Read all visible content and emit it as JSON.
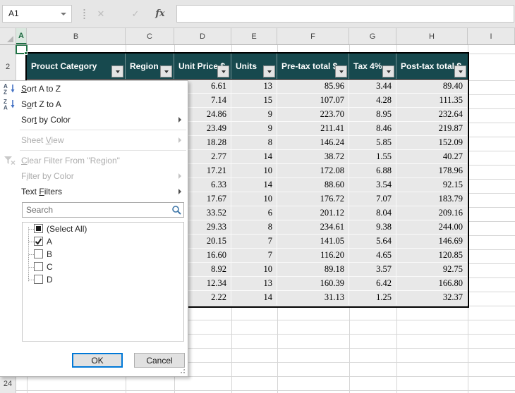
{
  "formula_bar": {
    "name_box_value": "A1",
    "cancel_glyph": "✕",
    "enter_glyph": "✓",
    "fx_label": "fx",
    "formula_value": ""
  },
  "sheet": {
    "column_headers": [
      "A",
      "B",
      "C",
      "D",
      "E",
      "F",
      "G",
      "H",
      "I"
    ],
    "active_column": "A",
    "row_top_label": "2",
    "row_bottom_label": "24"
  },
  "table": {
    "headers": [
      {
        "label": "Prouct Category"
      },
      {
        "label": "Region"
      },
      {
        "label": "Unit Price $"
      },
      {
        "label": "Units"
      },
      {
        "label": "Pre-tax total $"
      },
      {
        "label": "Tax 4%"
      },
      {
        "label": "Post-tax total $"
      }
    ],
    "rows": [
      [
        "6.61",
        "13",
        "85.96",
        "3.44",
        "89.40"
      ],
      [
        "7.14",
        "15",
        "107.07",
        "4.28",
        "111.35"
      ],
      [
        "24.86",
        "9",
        "223.70",
        "8.95",
        "232.64"
      ],
      [
        "23.49",
        "9",
        "211.41",
        "8.46",
        "219.87"
      ],
      [
        "18.28",
        "8",
        "146.24",
        "5.85",
        "152.09"
      ],
      [
        "2.77",
        "14",
        "38.72",
        "1.55",
        "40.27"
      ],
      [
        "17.21",
        "10",
        "172.08",
        "6.88",
        "178.96"
      ],
      [
        "6.33",
        "14",
        "88.60",
        "3.54",
        "92.15"
      ],
      [
        "17.67",
        "10",
        "176.72",
        "7.07",
        "183.79"
      ],
      [
        "33.52",
        "6",
        "201.12",
        "8.04",
        "209.16"
      ],
      [
        "29.33",
        "8",
        "234.61",
        "9.38",
        "244.00"
      ],
      [
        "20.15",
        "7",
        "141.05",
        "5.64",
        "146.69"
      ],
      [
        "16.60",
        "7",
        "116.20",
        "4.65",
        "120.85"
      ],
      [
        "8.92",
        "10",
        "89.18",
        "3.57",
        "92.75"
      ],
      [
        "12.34",
        "13",
        "160.39",
        "6.42",
        "166.80"
      ],
      [
        "2.22",
        "14",
        "31.13",
        "1.25",
        "32.37"
      ]
    ]
  },
  "filter_menu": {
    "items": [
      {
        "label": "Sort A to Z",
        "underline_index": 0,
        "icon": "sort-az-icon",
        "enabled": true,
        "submenu": false
      },
      {
        "label": "Sort Z to A",
        "underline_index": 1,
        "icon": "sort-za-icon",
        "enabled": true,
        "submenu": false
      },
      {
        "label": "Sort by Color",
        "underline_index": 3,
        "enabled": true,
        "submenu": true
      },
      {
        "separator": true
      },
      {
        "label": "Sheet View",
        "underline_index": 6,
        "enabled": false,
        "submenu": true
      },
      {
        "separator": true
      },
      {
        "label": "Clear Filter From \"Region\"",
        "underline_index": 0,
        "icon": "clear-filter-icon",
        "enabled": false,
        "submenu": false
      },
      {
        "label": "Filter by Color",
        "underline_index": 1,
        "enabled": false,
        "submenu": true
      },
      {
        "label": "Text Filters",
        "underline_index": 5,
        "enabled": true,
        "submenu": true
      }
    ],
    "search_placeholder": "Search",
    "checkbox_items": [
      {
        "label": "(Select All)",
        "state": "indeterminate"
      },
      {
        "label": "A",
        "state": "checked"
      },
      {
        "label": "B",
        "state": "unchecked"
      },
      {
        "label": "C",
        "state": "unchecked"
      },
      {
        "label": "D",
        "state": "unchecked"
      }
    ],
    "ok_label": "OK",
    "cancel_label": "Cancel"
  },
  "colors": {
    "table_header_bg": "#17494e",
    "table_cell_bg": "#e8e8e8",
    "table_border": "#000000",
    "active_cell_green": "#217346",
    "focus_blue": "#0078d7"
  }
}
